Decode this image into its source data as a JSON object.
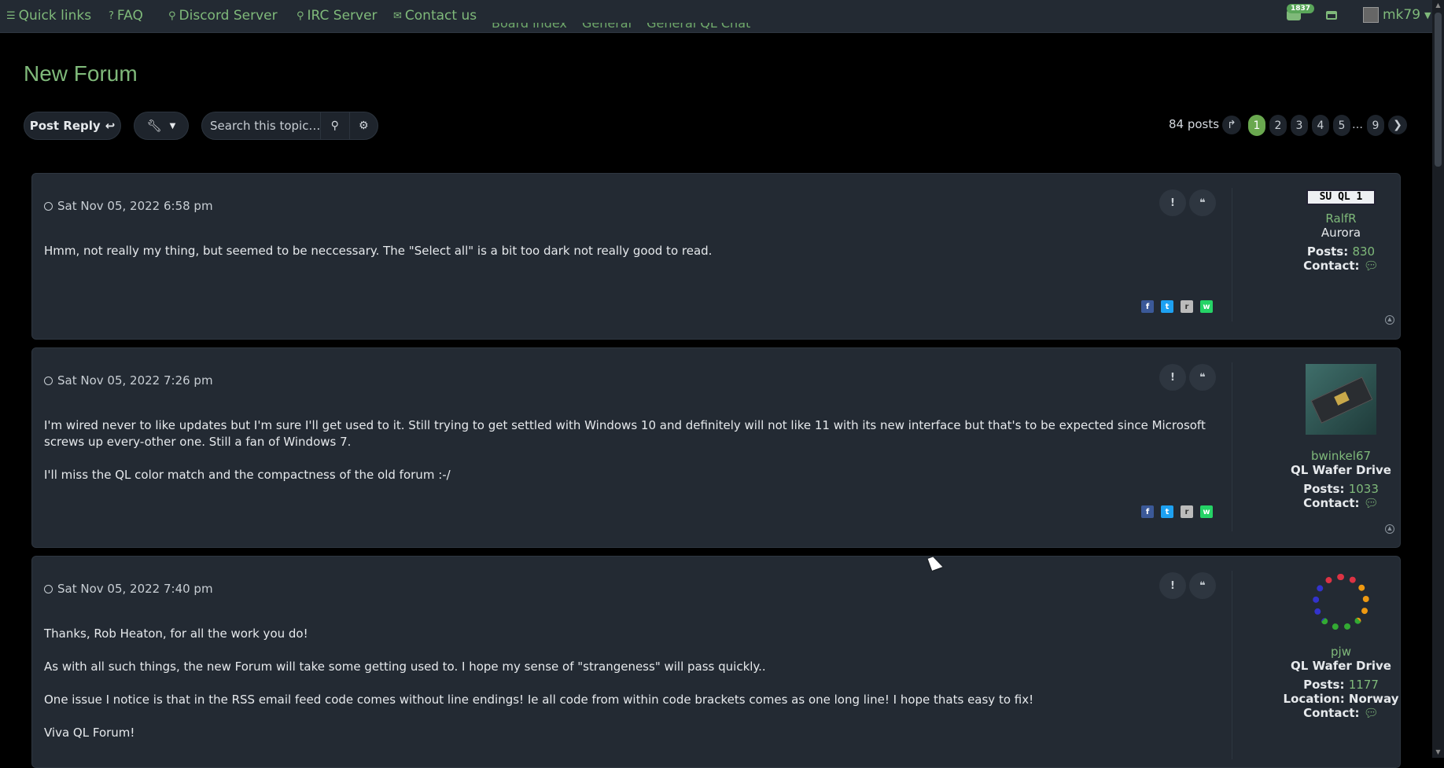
{
  "nav": {
    "quick_links": "Quick links",
    "faq": "FAQ",
    "discord": "Discord Server",
    "irc": "IRC Server",
    "contact": "Contact us",
    "notification_count": "1837",
    "username": "mk79"
  },
  "breadcrumbs": [
    "Board index",
    "General",
    "General QL Chat"
  ],
  "page": {
    "title": "New Forum"
  },
  "toolbar": {
    "post_reply": "Post Reply",
    "search_placeholder": "Search this topic…"
  },
  "pagination": {
    "post_count": "84 posts",
    "pages": [
      "1",
      "2",
      "3",
      "4",
      "5",
      "9"
    ],
    "ellipsis": "…",
    "current": "1"
  },
  "posts": [
    {
      "date": "Sat Nov 05, 2022 6:58 pm",
      "body": [
        "Hmm, not really my thing, but seemed to be neccessary. The \"Select all\" is a bit too dark not really good to read."
      ],
      "author": "RalfR",
      "rank": "Aurora",
      "avatar_text": "SU QL 1",
      "posts_label": "Posts:",
      "posts": "830",
      "contact_label": "Contact:"
    },
    {
      "date": "Sat Nov 05, 2022 7:26 pm",
      "body": [
        "I'm wired never to like updates but I'm sure I'll get used to it. Still trying to get settled with Windows 10 and definitely will not like 11 with its new interface but that's to be expected since Microsoft screws up every-other one. Still a fan of Windows 7.",
        "I'll miss the QL color match and the compactness of the old forum :-/"
      ],
      "author": "bwinkel67",
      "rank": "QL Wafer Drive",
      "posts_label": "Posts:",
      "posts": "1033",
      "contact_label": "Contact:"
    },
    {
      "date": "Sat Nov 05, 2022 7:40 pm",
      "body": [
        "Thanks, Rob Heaton, for all the work you do!",
        "As with all such things, the new Forum will take some getting used to. I hope my sense of \"strangeness\" will pass quickly..",
        "One issue I notice is that in the RSS email feed code comes without line endings! Ie all code from within code brackets comes as one long line! I hope thats easy to fix!",
        "Viva QL Forum!"
      ],
      "author": "pjw",
      "rank": "QL Wafer Drive",
      "posts_label": "Posts:",
      "posts": "1177",
      "location_label": "Location:",
      "location": "Norway",
      "contact_label": "Contact:"
    }
  ],
  "colors": {
    "accent": "#7fb97a",
    "active_page": "#6aa84f",
    "panel": "#232a33",
    "background": "#000000"
  },
  "icons": [
    "bars-icon",
    "question-circle-icon",
    "map-marker-icon",
    "envelope-icon",
    "bell-icon",
    "inbox-icon",
    "wrench-icon",
    "search-icon",
    "cog-icon",
    "reply-icon",
    "clock-icon",
    "report-icon",
    "quote-icon",
    "facebook-icon",
    "twitter-icon",
    "reddit-icon",
    "whatsapp-icon",
    "comment-icon",
    "arrow-up-icon",
    "chevron-right-icon",
    "jump-icon"
  ]
}
